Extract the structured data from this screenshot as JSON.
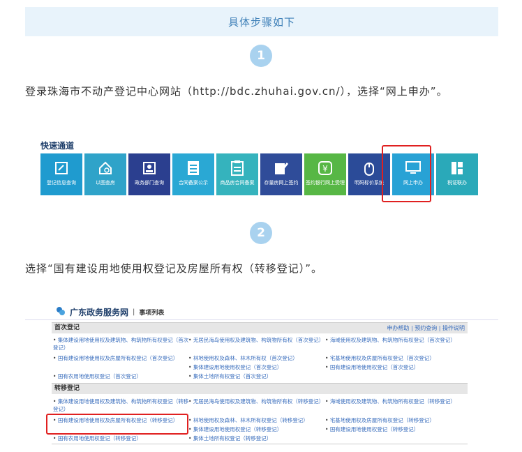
{
  "header": {
    "title": "具体步骤如下"
  },
  "steps": [
    {
      "num": "1",
      "text": "登录珠海市不动产登记中心网站（http://bdc.zhuhai.gov.cn/），选择“网上申办”。"
    },
    {
      "num": "2",
      "text": "选择“国有建设用地使用权登记及房屋所有权（转移登记）”。"
    }
  ],
  "quick_access": {
    "title": "快速通道",
    "tiles": [
      {
        "label": "登记信息查询",
        "icon": "search-doc-icon"
      },
      {
        "label": "以图查房",
        "icon": "house-search-icon"
      },
      {
        "label": "政务部门查询",
        "icon": "id-card-icon"
      },
      {
        "label": "合同备案公示",
        "icon": "list-doc-icon"
      },
      {
        "label": "商品房合同备案",
        "icon": "contract-icon"
      },
      {
        "label": "存量房网上签约",
        "icon": "sign-pen-icon"
      },
      {
        "label": "签约银行网上受理",
        "icon": "yuan-shield-icon"
      },
      {
        "label": "明码标价系统",
        "icon": "mouse-icon"
      },
      {
        "label": "网上申办",
        "icon": "monitor-icon"
      },
      {
        "label": "税证联办",
        "icon": "tax-icon"
      }
    ]
  },
  "gov_site": {
    "logo": "广东政务服务网",
    "sub": "事项列表",
    "sections": [
      {
        "title": "首次登记",
        "links": "申办帮助 | 预约查询 | 操作说明",
        "items": [
          [
            "集体建设用地使用权及建筑物、构筑物所有权登记（首次登记）",
            "无居民海岛使用权及建筑物、构筑物所有权（首次登记）",
            "海域使用权及建筑物、构筑物所有权登记（首次登记）"
          ],
          [
            "国有建设用地使用权及房屋所有权登记（首次登记）",
            "林地使用权及森林、林木所有权（首次登记）",
            "宅基地使用权及房屋所有权登记（首次登记）"
          ],
          [
            "国有农用地使用权登记（首次登记）",
            "集体建设用地使用权登记（首次登记）",
            "国有建设用地使用权登记（首次登记）"
          ],
          [
            "",
            "集体土地所有权登记（首次登记）",
            ""
          ]
        ]
      },
      {
        "title": "转移登记",
        "items": [
          [
            "集体建设用地使用权及建筑物、构筑物所有权登记（转移登记）",
            "无居民海岛使用权及建筑物、构筑物所有权（转移登记）",
            "海域使用权及建筑物、构筑物所有权登记（转移登记）"
          ],
          [
            "国有建设用地使用权及房屋所有权登记（转移登记）",
            "林地使用权及森林、林木所有权登记（转移登记）",
            "宅基地使用权及房屋所有权登记（转移登记）"
          ],
          [
            "国有农用地使用权登记（转移登记）",
            "集体建设用地使用权登记（转移登记）",
            "国有建设用地使用权登记（转移登记）"
          ],
          [
            "",
            "集体土地所有权登记（转移登记）",
            ""
          ]
        ]
      }
    ]
  }
}
